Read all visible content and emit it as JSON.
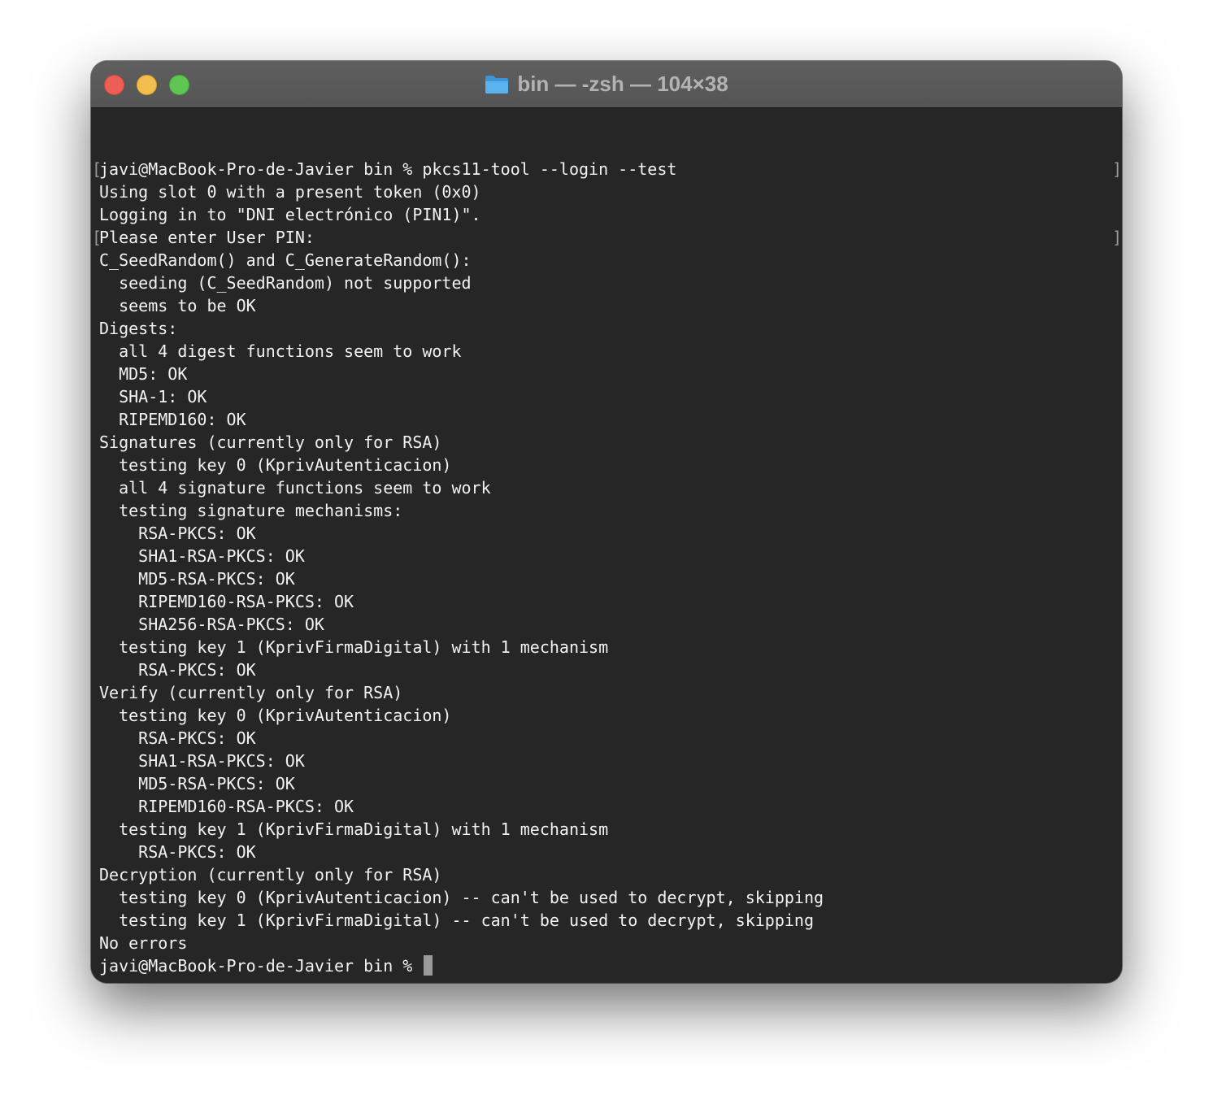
{
  "window": {
    "title": "bin — -zsh — 104×38",
    "title_icon": "folder-icon",
    "accent_colors": {
      "close": "#ec5f57",
      "minimize": "#f4bd4f",
      "zoom": "#61c554",
      "folder": "#4aa8e8"
    }
  },
  "terminal": {
    "lines": [
      "javi@MacBook-Pro-de-Javier bin % pkcs11-tool --login --test",
      "Using slot 0 with a present token (0x0)",
      "Logging in to \"DNI electrónico (PIN1)\".",
      "Please enter User PIN:",
      "C_SeedRandom() and C_GenerateRandom():",
      "  seeding (C_SeedRandom) not supported",
      "  seems to be OK",
      "Digests:",
      "  all 4 digest functions seem to work",
      "  MD5: OK",
      "  SHA-1: OK",
      "  RIPEMD160: OK",
      "Signatures (currently only for RSA)",
      "  testing key 0 (KprivAutenticacion)",
      "  all 4 signature functions seem to work",
      "  testing signature mechanisms:",
      "    RSA-PKCS: OK",
      "    SHA1-RSA-PKCS: OK",
      "    MD5-RSA-PKCS: OK",
      "    RIPEMD160-RSA-PKCS: OK",
      "    SHA256-RSA-PKCS: OK",
      "  testing key 1 (KprivFirmaDigital) with 1 mechanism",
      "    RSA-PKCS: OK",
      "Verify (currently only for RSA)",
      "  testing key 0 (KprivAutenticacion)",
      "    RSA-PKCS: OK",
      "    SHA1-RSA-PKCS: OK",
      "    MD5-RSA-PKCS: OK",
      "    RIPEMD160-RSA-PKCS: OK",
      "  testing key 1 (KprivFirmaDigital) with 1 mechanism",
      "    RSA-PKCS: OK",
      "Decryption (currently only for RSA)",
      "  testing key 0 (KprivAutenticacion) -- can't be used to decrypt, skipping",
      "  testing key 1 (KprivFirmaDigital) -- can't be used to decrypt, skipping",
      "No errors"
    ],
    "prompt": "javi@MacBook-Pro-de-Javier bin % ",
    "bracket_open": "[",
    "bracket_close": "]"
  }
}
